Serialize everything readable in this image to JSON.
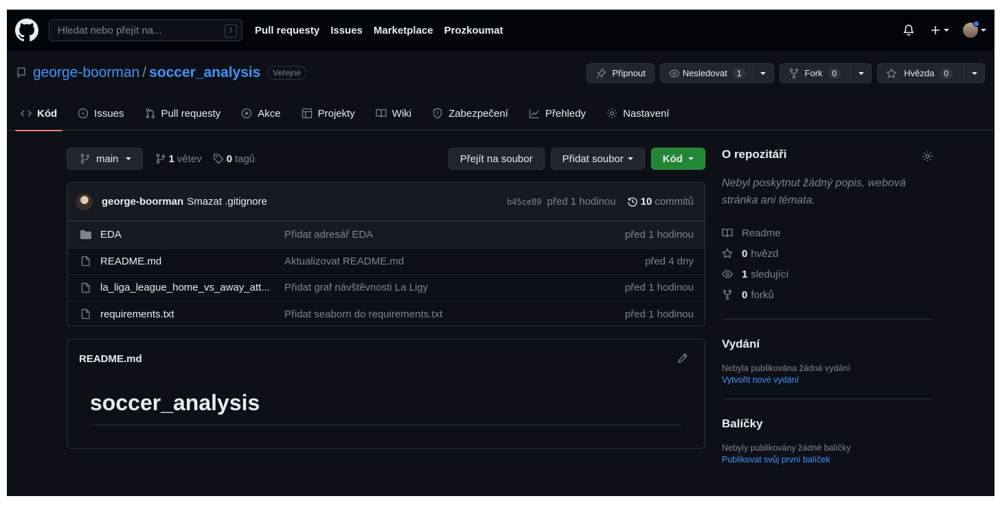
{
  "header": {
    "search_placeholder": "Hledat nebo přejít na...",
    "search_shortcut": "/",
    "nav": [
      "Pull requesty",
      "Issues",
      "Marketplace",
      "Prozkoumat"
    ]
  },
  "repo": {
    "owner": "george-boorman",
    "separator": "/",
    "name": "soccer_analysis",
    "visibility": "Veřejné",
    "actions": {
      "pin_label": "Připnout",
      "watch_label": "Nesledovat",
      "watch_count": "1",
      "fork_label": "Fork",
      "fork_count": "0",
      "star_label": "Hvězda",
      "star_count": "0"
    },
    "tabs": [
      "Kód",
      "Issues",
      "Pull requesty",
      "Akce",
      "Projekty",
      "Wiki",
      "Zabezpečení",
      "Přehledy",
      "Nastavení"
    ]
  },
  "branch_bar": {
    "branch": "main",
    "branches_count": "1",
    "branches_label": "větev",
    "tags_count": "0",
    "tags_label": "tagů",
    "goto_file": "Přejít na soubor",
    "add_file": "Přidat soubor",
    "code": "Kód"
  },
  "latest_commit": {
    "author": "george-boorman",
    "message": "Smazat .gitignore",
    "sha": "b45ce89",
    "time": "před 1 hodinou",
    "commits_count": "10",
    "commits_label": "commitů"
  },
  "files": [
    {
      "type": "folder",
      "name": "EDA",
      "message": "Přidat adresář EDA",
      "time": "před 1 hodinou"
    },
    {
      "type": "file",
      "name": "README.md",
      "message": "Aktualizovat README.md",
      "time": "před 4 dny"
    },
    {
      "type": "file",
      "name": "la_liga_league_home_vs_away_att...",
      "message": "Přidat graf návštěvnosti La Ligy",
      "time": "před 1 hodinou"
    },
    {
      "type": "file",
      "name": "requirements.txt",
      "message": "Přidat seaborn do requirements.txt",
      "time": "před 1 hodinou"
    }
  ],
  "readme": {
    "filename": "README.md",
    "heading": "soccer_analysis"
  },
  "sidebar": {
    "about_title": "O repozitáři",
    "description": "Nebyl poskytnut žádný popis, webová stránka ani témata.",
    "readme_label": "Readme",
    "stars_count": "0",
    "stars_label": "hvězd",
    "watchers_count": "1",
    "watchers_label": "sledující",
    "forks_count": "0",
    "forks_label": "forků",
    "releases_title": "Vydání",
    "releases_none": "Nebyla publikována žádná vydání",
    "releases_link": "Vytvořit nové vydání",
    "packages_title": "Balíčky",
    "packages_none": "Nebyly publikovány žádné balíčky",
    "packages_link": "Publikovat svůj první balíček"
  },
  "colors": {
    "background": "#0d1117",
    "header": "#010409",
    "link": "#4493f8",
    "primary_button": "#238636",
    "active_tab_underline": "#f78166"
  }
}
